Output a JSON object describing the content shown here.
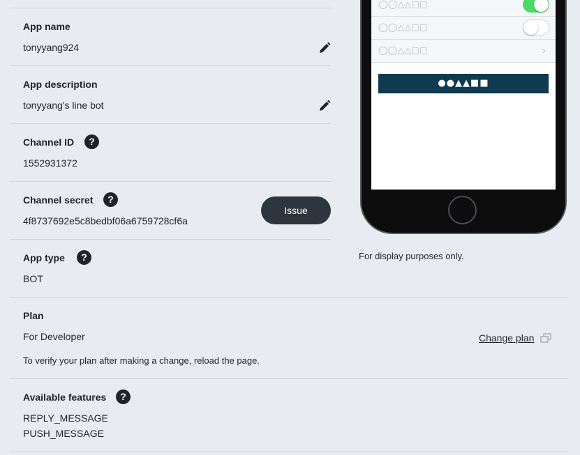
{
  "fields": {
    "app_name": {
      "label": "App name",
      "value": "tonyyang924"
    },
    "app_description": {
      "label": "App description",
      "value": "tonyyang's line bot"
    },
    "channel_id": {
      "label": "Channel ID",
      "value": "1552931372"
    },
    "channel_secret": {
      "label": "Channel secret",
      "value": "4f8737692e5c8bedbf06a6759728cf6a",
      "button": "Issue"
    },
    "app_type": {
      "label": "App type",
      "value": "BOT"
    },
    "plan": {
      "label": "Plan",
      "value": "For Developer",
      "link": "Change plan",
      "note": "To verify your plan after making a change, reload the page."
    },
    "available_features": {
      "label": "Available features",
      "items": [
        "REPLY_MESSAGE",
        "PUSH_MESSAGE"
      ]
    }
  },
  "help_glyph": "?",
  "preview": {
    "rows": [
      "◯◯△△□□",
      "◯◯△△□□",
      "◯◯△△□□"
    ],
    "chevron": "›",
    "button": "●●▲▲■■",
    "note": "For display purposes only.",
    "toggle_on_color": "#4cd964"
  },
  "icons": [
    "pencil-icon",
    "help-icon",
    "external-link-icon",
    "chevron-right-icon"
  ]
}
